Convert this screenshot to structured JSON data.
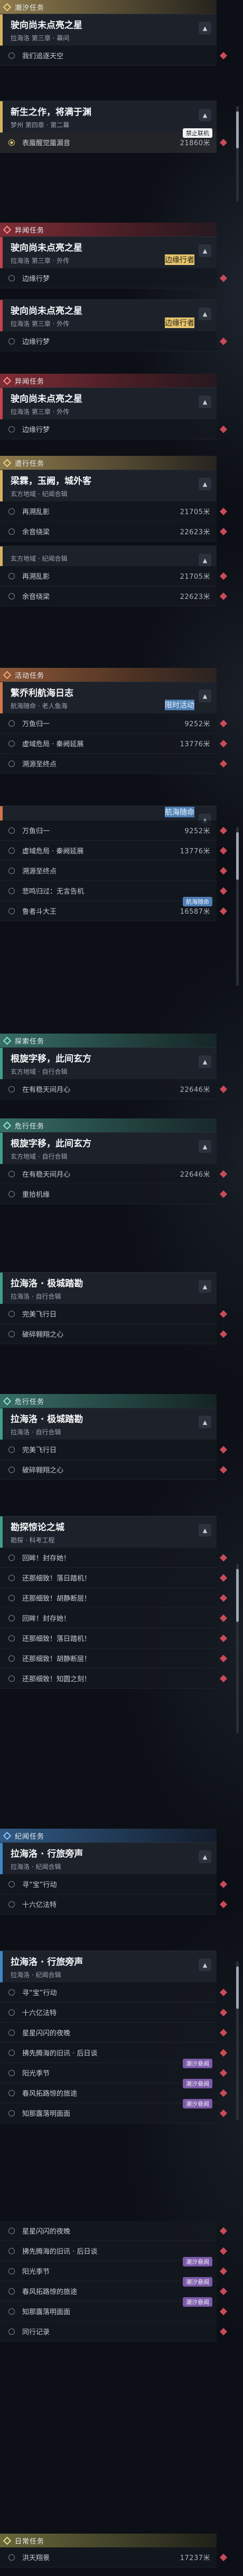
{
  "sections": [
    {
      "category": "潮汐任务",
      "color": "gold",
      "title": "驶向尚未点亮之星",
      "subtitle": "拉海洛 第三章 · 幕间",
      "rows": [
        {
          "label": "我们追逐天空"
        }
      ]
    },
    {
      "category": "",
      "color": "gold",
      "title": "新生之作，将满于渊",
      "subtitle": "梦州 第四章 · 第二幕",
      "rows": [
        {
          "label": "表蜃醒觉蜃漏音",
          "distance": "21860米",
          "active": true,
          "tag": "禁止联机",
          "tag_color": "white"
        }
      ]
    },
    {
      "category": "异闻任务",
      "color": "red",
      "title": "驶向尚未点亮之星",
      "subtitle": "拉海洛 第三章 · 外传",
      "tag": "边缘行者",
      "rows": [
        {
          "label": "边缘行梦"
        }
      ]
    },
    {
      "category": "",
      "color": "red",
      "title": "驶向尚未点亮之星",
      "subtitle": "拉海洛 第三章 · 外传",
      "tag": "边缘行者",
      "rows": [
        {
          "label": "边缘行梦"
        }
      ]
    },
    {
      "category": "异闻任务",
      "color": "red",
      "title": "驶向尚未点亮之星",
      "subtitle": "拉海洛 第三章 · 外传",
      "rows": [
        {
          "label": "边缘行梦"
        }
      ]
    },
    {
      "category": "遗行任务",
      "color": "gold",
      "title": "梁霖，玉阙，城外客",
      "subtitle": "玄方地域 · 纪闻合辑",
      "rows": [
        {
          "label": "再溯乱影",
          "distance": "21705米"
        },
        {
          "label": "余音绕梁",
          "distance": "22623米"
        }
      ]
    },
    {
      "category": "",
      "color": "gold",
      "title": "",
      "subtitle": "玄方地域 · 纪闻合辑",
      "rows": [
        {
          "label": "再溯乱影",
          "distance": "21705米"
        },
        {
          "label": "余音绕梁",
          "distance": "22623米"
        }
      ]
    },
    {
      "category": "活动任务",
      "color": "copper",
      "title": "繁乔利航海日志",
      "subtitle": "航海随命 · 老人鱼海",
      "tag": "限时活动",
      "tag_color": "blue",
      "rows": [
        {
          "label": "万鱼归一",
          "distance": "9252米"
        },
        {
          "label": "虚域危局 · 秦阙延展",
          "distance": "13776米"
        },
        {
          "label": "溯源至终点"
        }
      ]
    },
    {
      "category": "",
      "color": "copper",
      "title": "",
      "subtitle": "",
      "tag": "航海随命",
      "tag_color": "blue",
      "rows": [
        {
          "label": "万鱼归一",
          "distance": "9252米"
        },
        {
          "label": "虚域危局 · 秦阙延展",
          "distance": "13776米"
        },
        {
          "label": "溯源至终点"
        },
        {
          "label": "悲鸣归过：无言告机"
        },
        {
          "label": "鲁者斗大王",
          "distance": "16587米",
          "tag": "航海随命",
          "tag_color": "blue"
        }
      ]
    },
    {
      "category": "探索任务",
      "color": "teal",
      "title": "根旋字移，此间玄方",
      "subtitle": "玄方地域 · 自行合辑",
      "rows": [
        {
          "label": "在有稳天间月心",
          "distance": "22646米"
        }
      ]
    },
    {
      "category": "危行任务",
      "color": "teal",
      "title": "根旋字移，此间玄方",
      "subtitle": "玄方地域 · 自行合辑",
      "rows": [
        {
          "label": "在有稳天间月心",
          "distance": "22646米"
        },
        {
          "label": "重拾机缘"
        }
      ]
    },
    {
      "category": "",
      "color": "teal",
      "title": "拉海洛 · 极城踏勘",
      "subtitle": "拉海洛 · 自行合辑",
      "rows": [
        {
          "label": "完美飞行日"
        },
        {
          "label": "破碎翱翔之心"
        }
      ]
    },
    {
      "category": "危行任务",
      "color": "teal",
      "title": "拉海洛 · 极城踏勘",
      "subtitle": "拉海洛 · 自行合辑",
      "rows": [
        {
          "label": "完美飞行日"
        },
        {
          "label": "破碎翱翔之心"
        }
      ]
    },
    {
      "category": "",
      "color": "teal",
      "title": "勘探惊论之城",
      "subtitle": "勘探 · 科考工程",
      "rows": [
        {
          "label": "回眸！封存她！"
        },
        {
          "label": "还那细致！落日踏机！"
        },
        {
          "label": "还那细致！胡静断层！"
        },
        {
          "label": "回眸！封存她！"
        },
        {
          "label": "还那细致！落日踏机！"
        },
        {
          "label": "还那细致！胡静断层！"
        },
        {
          "label": "还那细致！知圆之刻！"
        }
      ]
    },
    {
      "category": "纪闻任务",
      "color": "blue",
      "title": "拉海洛 · 行旅旁声",
      "subtitle": "拉海洛 · 纪闻合辑",
      "rows": [
        {
          "label": "寻“宝”行动"
        },
        {
          "label": "十六亿法特"
        }
      ]
    },
    {
      "category": "",
      "color": "blue",
      "title": "拉海洛 · 行旅旁声",
      "subtitle": "拉海洛 · 纪闻合辑",
      "rows": [
        {
          "label": "寻“宝”行动"
        },
        {
          "label": "十六亿法特"
        },
        {
          "label": "星星闪闪的夜晚"
        },
        {
          "label": "拂先腾海的旧讯 · 后日谈"
        },
        {
          "label": "阳光季节",
          "tag": "潮汐悬闻",
          "tag_color": "purple"
        },
        {
          "label": "春风拓路惊的旅途",
          "tag": "潮汐悬闻",
          "tag_color": "purple"
        },
        {
          "label": "知那露落明面面",
          "tag": "潮汐悬闻",
          "tag_color": "purple"
        }
      ]
    },
    {
      "category": "",
      "color": "blue",
      "title": "",
      "subtitle": "",
      "rows": [
        {
          "label": "星星闪闪的夜晚"
        },
        {
          "label": "拂先腾海的旧讯 · 后日谈"
        },
        {
          "label": "阳光季节",
          "tag": "潮汐悬闻",
          "tag_color": "purple"
        },
        {
          "label": "春风拓路惊的旅途",
          "tag": "潮汐悬闻",
          "tag_color": "purple"
        },
        {
          "label": "知那露落明面面",
          "tag": "潮汐悬闻",
          "tag_color": "purple"
        },
        {
          "label": "同行记录"
        }
      ]
    },
    {
      "category": "日常任务",
      "color": "olive",
      "title": "",
      "subtitle": "",
      "rows": [
        {
          "label": "洪天翔景",
          "distance": "17237米"
        }
      ]
    }
  ]
}
